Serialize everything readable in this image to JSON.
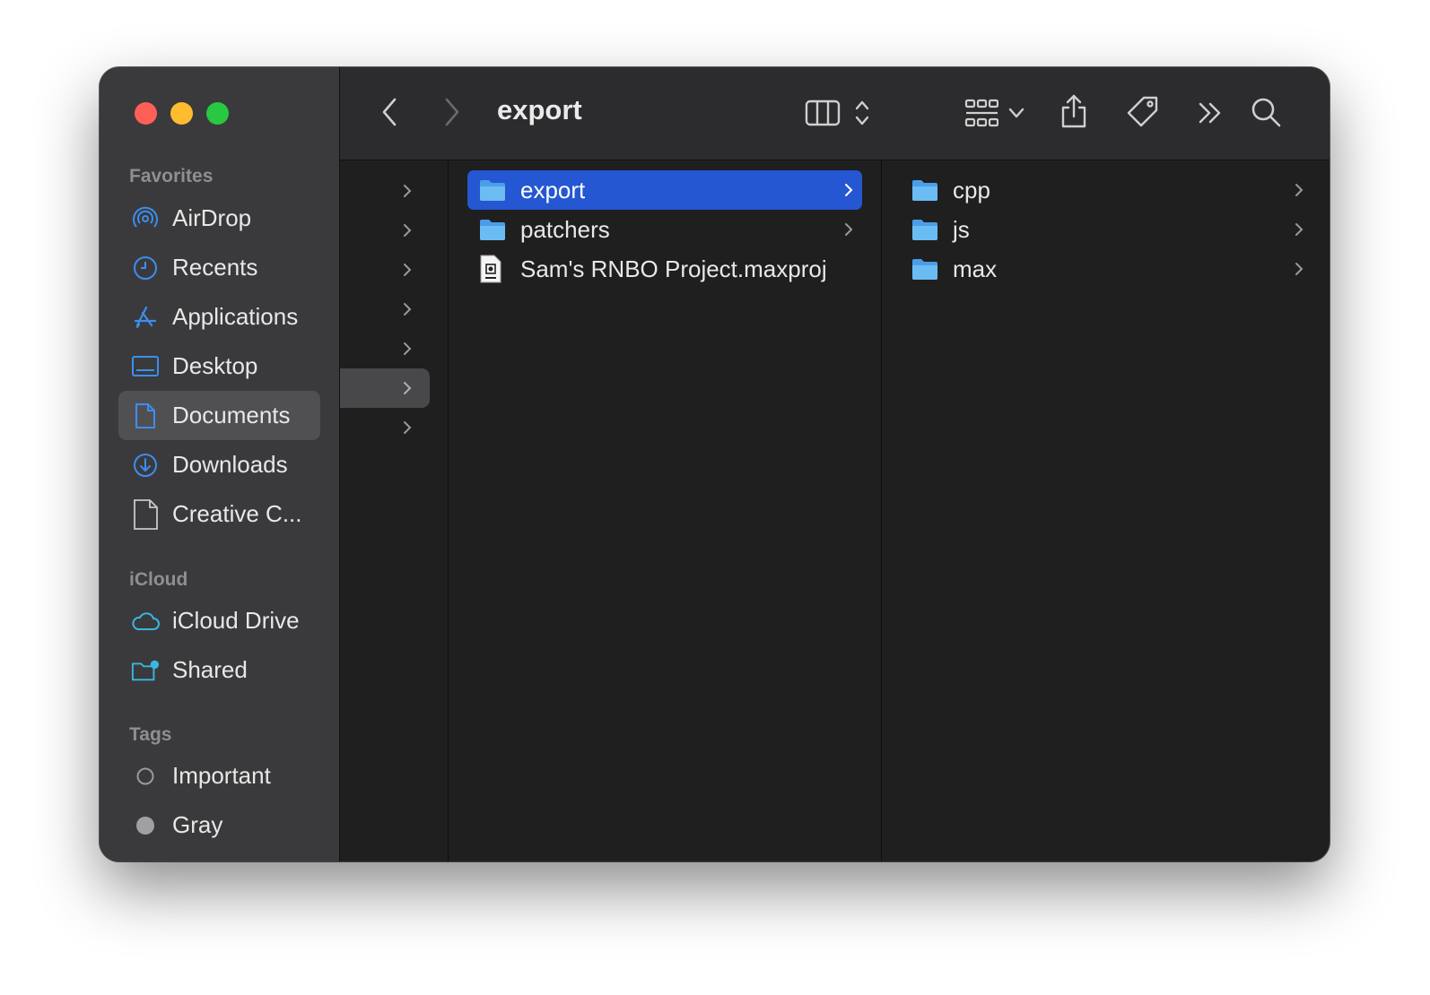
{
  "window": {
    "title": "export"
  },
  "colors": {
    "accent": "#2457d1",
    "sidebar_icon": "#3b8ef0",
    "folder": "#5eb0f0"
  },
  "sidebar": {
    "sections": [
      {
        "title": "Favorites"
      },
      {
        "title": "iCloud"
      },
      {
        "title": "Tags"
      }
    ],
    "favorites": [
      {
        "label": "AirDrop",
        "icon": "airdrop-icon"
      },
      {
        "label": "Recents",
        "icon": "clock-icon"
      },
      {
        "label": "Applications",
        "icon": "applications-icon"
      },
      {
        "label": "Desktop",
        "icon": "desktop-icon"
      },
      {
        "label": "Documents",
        "icon": "document-icon",
        "selected": true
      },
      {
        "label": "Downloads",
        "icon": "download-icon"
      },
      {
        "label": "Creative C...",
        "icon": "file-icon"
      }
    ],
    "icloud": [
      {
        "label": "iCloud Drive",
        "icon": "cloud-icon"
      },
      {
        "label": "Shared",
        "icon": "shared-folder-icon"
      }
    ],
    "tags": [
      {
        "label": "Important",
        "icon": "tag-circle-empty-icon"
      },
      {
        "label": "Gray",
        "icon": "tag-circle-gray-icon"
      }
    ]
  },
  "toolbar": {
    "back_icon": "chevron-left-icon",
    "forward_icon": "chevron-right-icon",
    "view_icon": "column-view-icon",
    "group_icon": "group-grid-icon",
    "share_icon": "share-icon",
    "tag_icon": "tag-icon",
    "more_icon": "double-chevron-icon",
    "search_icon": "search-icon"
  },
  "columns": {
    "middle": [
      {
        "name": "export",
        "type": "folder",
        "selected": true
      },
      {
        "name": "patchers",
        "type": "folder"
      },
      {
        "name": "Sam's RNBO Project.maxproj",
        "type": "file"
      }
    ],
    "right": [
      {
        "name": "cpp",
        "type": "folder"
      },
      {
        "name": "js",
        "type": "folder"
      },
      {
        "name": "max",
        "type": "folder"
      }
    ]
  }
}
